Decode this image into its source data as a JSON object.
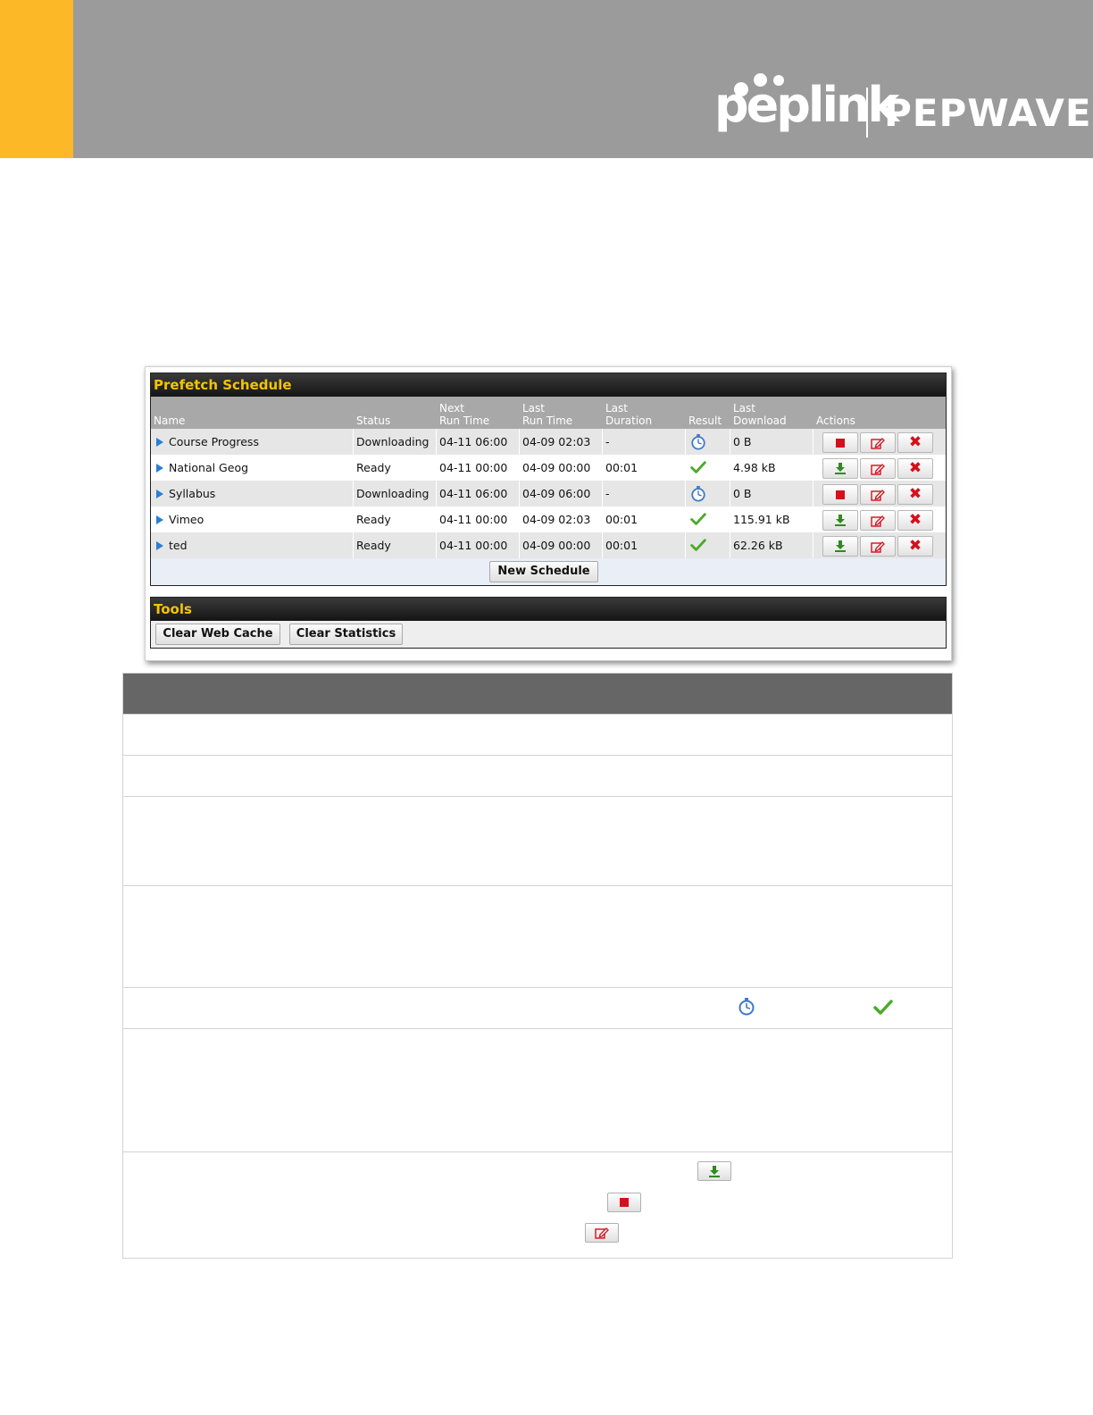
{
  "brand": {
    "logo_text": "peplink",
    "logo_text_2": "PEPWAVE"
  },
  "prefetch": {
    "title": "Prefetch Schedule",
    "headers": {
      "name": "Name",
      "status": "Status",
      "next_run_1": "Next",
      "next_run_2": "Run Time",
      "last_run_1": "Last",
      "last_run_2": "Run Time",
      "last_duration_1": "Last",
      "last_duration_2": "Duration",
      "result": "Result",
      "last_download_1": "Last",
      "last_download_2": "Download",
      "actions": "Actions"
    },
    "rows": [
      {
        "name": "Course Progress",
        "status": "Downloading",
        "next_run": "04-11 06:00",
        "last_run": "04-09 02:03",
        "last_duration": "-",
        "result": "running-icon",
        "last_download": "0 B",
        "primary_action": "stop"
      },
      {
        "name": "National Geog",
        "status": "Ready",
        "next_run": "04-11 00:00",
        "last_run": "04-09 00:00",
        "last_duration": "00:01",
        "result": "success-icon",
        "last_download": "4.98 kB",
        "primary_action": "download"
      },
      {
        "name": "Syllabus",
        "status": "Downloading",
        "next_run": "04-11 06:00",
        "last_run": "04-09 06:00",
        "last_duration": "-",
        "result": "running-icon",
        "last_download": "0 B",
        "primary_action": "stop"
      },
      {
        "name": "Vimeo",
        "status": "Ready",
        "next_run": "04-11 00:00",
        "last_run": "04-09 02:03",
        "last_duration": "00:01",
        "result": "success-icon",
        "last_download": "115.91 kB",
        "primary_action": "download"
      },
      {
        "name": "ted",
        "status": "Ready",
        "next_run": "04-11 00:00",
        "last_run": "04-09 00:00",
        "last_duration": "00:01",
        "result": "success-icon",
        "last_download": "62.26 kB",
        "primary_action": "download"
      }
    ],
    "new_schedule_label": "New Schedule"
  },
  "tools": {
    "title": "Tools",
    "clear_web_cache_label": "Clear Web Cache",
    "clear_statistics_label": "Clear Statistics"
  },
  "colors": {
    "accent": "#fdb827",
    "header_gray": "#9b9b9b",
    "section_title": "#f5c400",
    "stop_red": "#d4101c",
    "download_green": "#2f8a1f",
    "success_green": "#4caa2a"
  }
}
